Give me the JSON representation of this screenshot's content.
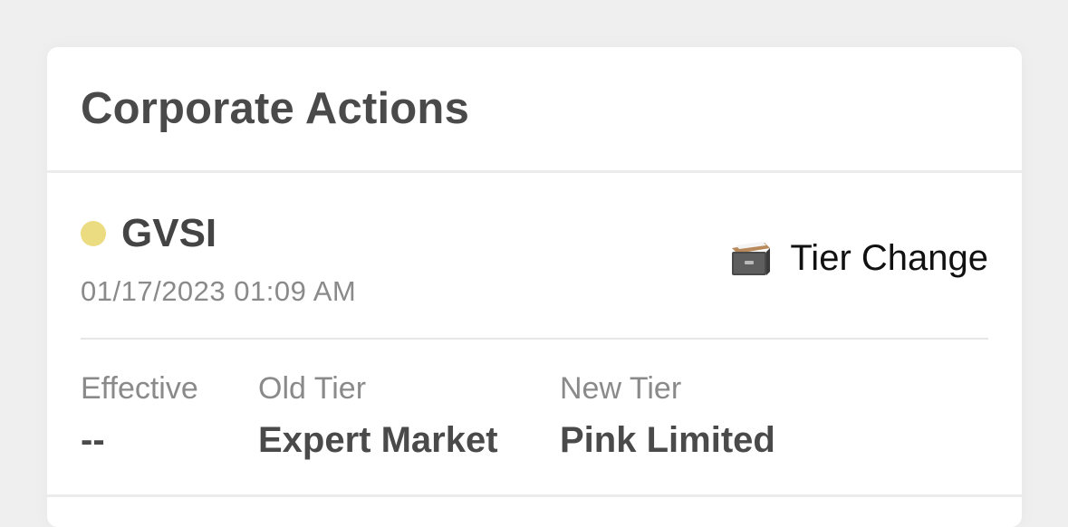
{
  "section": {
    "title": "Corporate Actions"
  },
  "actions": [
    {
      "symbol": "GVSI",
      "status_color": "#ebdc81",
      "timestamp": "01/17/2023 01:09 AM",
      "type_icon": "file-cabinet-icon",
      "type_label": "Tier Change",
      "fields": {
        "effective_label": "Effective",
        "effective_value": "--",
        "old_tier_label": "Old Tier",
        "old_tier_value": "Expert Market",
        "new_tier_label": "New Tier",
        "new_tier_value": "Pink Limited"
      }
    }
  ]
}
